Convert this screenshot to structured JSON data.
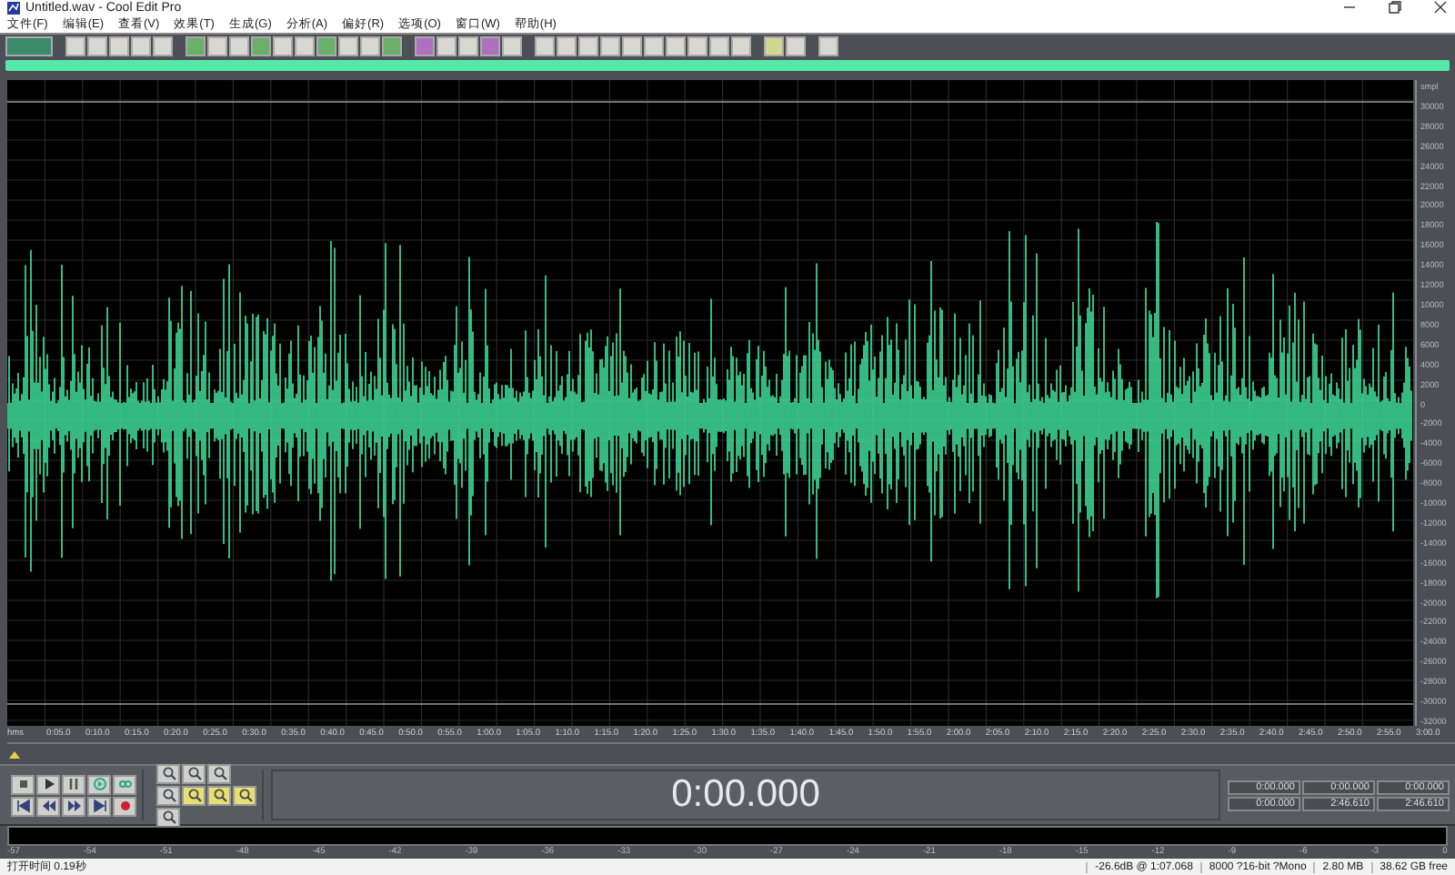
{
  "window": {
    "title": "Untitled.wav - Cool Edit Pro"
  },
  "menu": [
    {
      "label": "文件(F)"
    },
    {
      "label": "编辑(E)"
    },
    {
      "label": "查看(V)"
    },
    {
      "label": "效果(T)"
    },
    {
      "label": "生成(G)"
    },
    {
      "label": "分析(A)"
    },
    {
      "label": "偏好(R)"
    },
    {
      "label": "选项(O)"
    },
    {
      "label": "窗口(W)"
    },
    {
      "label": "帮助(H)"
    }
  ],
  "amplitude_axis": {
    "unit": "smpl",
    "labels": [
      "30000",
      "28000",
      "26000",
      "24000",
      "22000",
      "20000",
      "18000",
      "16000",
      "14000",
      "12000",
      "10000",
      "8000",
      "6000",
      "4000",
      "2000",
      "0",
      "-2000",
      "-4000",
      "-6000",
      "-8000",
      "-10000",
      "-12000",
      "-14000",
      "-16000",
      "-18000",
      "-20000",
      "-22000",
      "-24000",
      "-26000",
      "-28000",
      "-30000",
      "-32000"
    ]
  },
  "time_ruler": {
    "unit": "hms",
    "labels": [
      "0:05.0",
      "0:10.0",
      "0:15.0",
      "0:20.0",
      "0:25.0",
      "0:30.0",
      "0:35.0",
      "0:40.0",
      "0:45.0",
      "0:50.0",
      "0:55.0",
      "1:00.0",
      "1:05.0",
      "1:10.0",
      "1:15.0",
      "1:20.0",
      "1:25.0",
      "1:30.0",
      "1:35.0",
      "1:40.0",
      "1:45.0",
      "1:50.0",
      "1:55.0",
      "2:00.0",
      "2:05.0",
      "2:10.0",
      "2:15.0",
      "2:20.0",
      "2:25.0",
      "2:30.0",
      "2:35.0",
      "2:40.0",
      "2:45.0",
      "2:50.0",
      "2:55.0",
      "3:00.0"
    ]
  },
  "time_display": "0:00.000",
  "selection_view": [
    [
      "0:00.000",
      "0:00.000",
      "0:00.000"
    ],
    [
      "0:00.000",
      "2:46.610",
      "2:46.610"
    ]
  ],
  "level_meter": {
    "labels": [
      "-57",
      "-54",
      "-51",
      "-48",
      "-45",
      "-42",
      "-39",
      "-36",
      "-33",
      "-30",
      "-27",
      "-24",
      "-21",
      "-18",
      "-15",
      "-12",
      "-9",
      "-6",
      "-3",
      "0"
    ]
  },
  "status_bar": [
    "打开时间 0.19秒",
    "-26.6dB @ 1:07.068",
    "8000 ?16-bit ?Mono",
    "2.80 MB",
    "38.62 GB free"
  ]
}
